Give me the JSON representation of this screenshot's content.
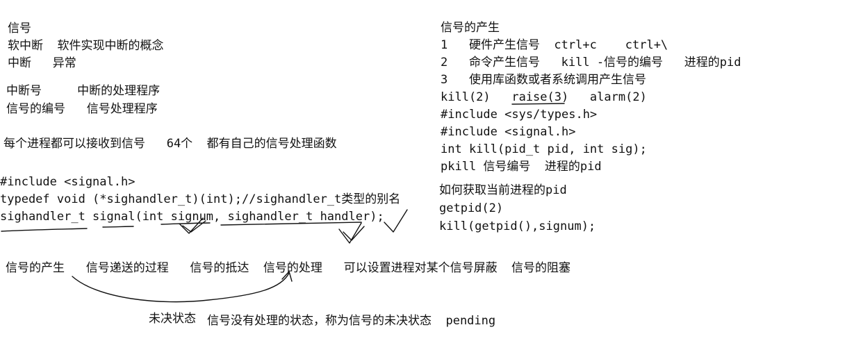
{
  "left": {
    "lines": [
      "信号",
      "软中断  软件实现中断的概念",
      "中断   异常",
      "中断号     中断的处理程序",
      "信号的编号   信号处理程序",
      "每个进程都可以接收到信号   64个  都有自己的信号处理函数",
      "#include <signal.h>",
      "typedef void (*sighandler_t)(int);//sighandler_t类型的别名",
      "sighandler_t signal(int signum, sighandler_t handler);"
    ]
  },
  "right": {
    "lines": [
      "信号的产生",
      "1   硬件产生信号  ctrl+c    ctrl+\\",
      "2   命令产生信号   kill -信号的编号   进程的pid",
      "3   使用库函数或者系统调用产生信号",
      "kill(2)   raise(3)   alarm(2)",
      "#include <sys/types.h>",
      "#include <signal.h>",
      "int kill(pid_t pid, int sig);",
      "pkill 信号编号  进程的pid",
      "如何获取当前进程的pid",
      "getpid(2)",
      "kill(getpid(),signum);"
    ]
  },
  "bottom": {
    "flow": "信号的产生   信号递送的过程   信号的抵达  信号的处理   可以设置进程对某个信号屏蔽  信号的阻塞",
    "pending_label": "未决状态",
    "pending_text": "信号没有处理的状态，称为信号的未决状态  pending"
  },
  "colors": {
    "ink": "#111111",
    "background": "#ffffff"
  }
}
